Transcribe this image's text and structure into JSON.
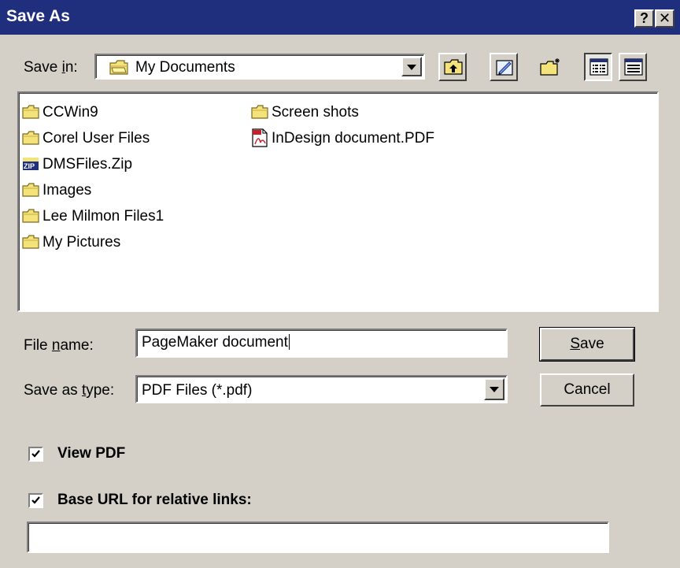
{
  "window": {
    "title": "Save As",
    "help_button": "?",
    "close_button": "✕"
  },
  "save_in": {
    "label_pre": "Save ",
    "label_accel": "i",
    "label_post": "n:",
    "value": "My Documents"
  },
  "toolbar": {
    "icons": [
      "up-folder-icon",
      "desktop-icon",
      "new-folder-icon",
      "list-view-icon",
      "details-view-icon"
    ]
  },
  "files": [
    {
      "name": "CCWin9",
      "type": "folder"
    },
    {
      "name": "Corel User Files",
      "type": "folder"
    },
    {
      "name": "DMSFiles.Zip",
      "type": "zip"
    },
    {
      "name": "Images",
      "type": "folder"
    },
    {
      "name": "Lee Milmon Files1",
      "type": "folder"
    },
    {
      "name": "My Pictures",
      "type": "folder"
    },
    {
      "name": "Screen shots",
      "type": "folder"
    },
    {
      "name": "InDesign document.PDF",
      "type": "pdf"
    }
  ],
  "file_name": {
    "label_pre": "File ",
    "label_accel": "n",
    "label_post": "ame:",
    "value": "PageMaker document"
  },
  "save_as_type": {
    "label_pre": "Save as ",
    "label_accel": "t",
    "label_post": "ype:",
    "value": "PDF Files (*.pdf)"
  },
  "buttons": {
    "save_accel": "S",
    "save_rest": "ave",
    "cancel": "Cancel"
  },
  "options": {
    "view_pdf_label": "View PDF",
    "view_pdf_checked": true,
    "base_url_label": "Base URL for relative links:",
    "base_url_checked": true,
    "base_url_value": ""
  },
  "colors": {
    "titlebar": "#1f2f7d",
    "face": "#d4d0c8",
    "folder_yellow": "#f4e27a"
  }
}
